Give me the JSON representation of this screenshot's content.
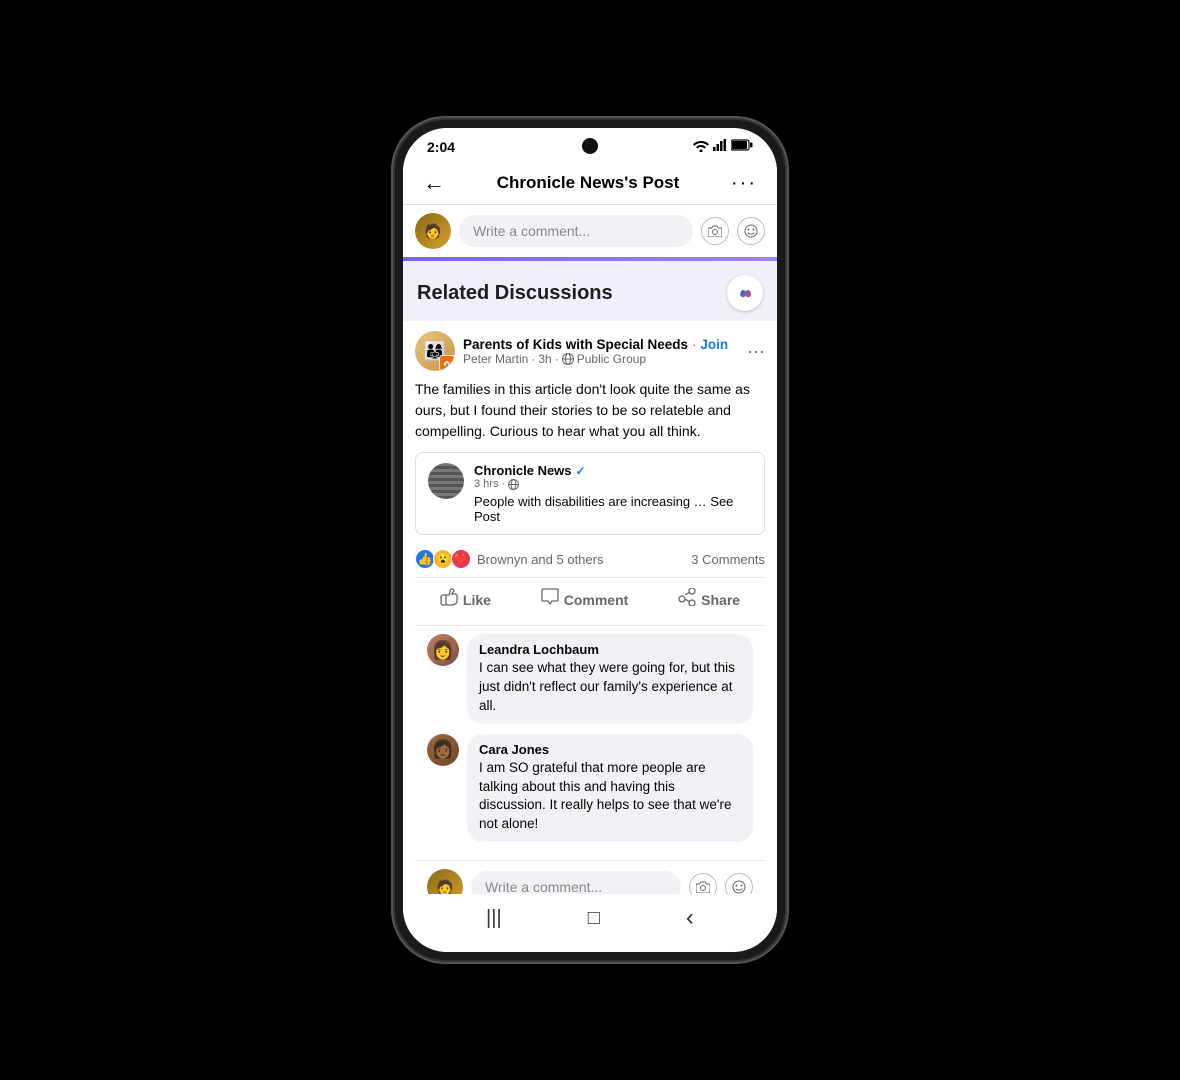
{
  "status_bar": {
    "time": "2:04",
    "wifi": "▼",
    "signal": "▲",
    "battery": "🔋"
  },
  "nav": {
    "title": "Chronicle News's Post",
    "back": "←",
    "more": "···"
  },
  "comment_input_top": {
    "placeholder": "Write a comment..."
  },
  "related_discussions": {
    "title": "Related Discussions"
  },
  "post": {
    "group_name": "Parents of Kids with Special Needs",
    "join_label": "Join",
    "author": "Peter Martin",
    "time": "3h",
    "group_type": "Public Group",
    "body": "The families in this article don't look quite the same as ours, but I found their stories to be so relateble and compelling. Curious to hear what you all think.",
    "embedded": {
      "source_name": "Chronicle News",
      "time": "3 hrs",
      "text": "People with disabilities are increasing … See Post"
    },
    "reactions": {
      "names": "Brownyn and 5 others",
      "comments_count": "3 Comments"
    },
    "actions": {
      "like": "Like",
      "comment": "Comment",
      "share": "Share"
    }
  },
  "comments": [
    {
      "author": "Leandra Lochbaum",
      "text": "I can see what they were going for, but this just didn't reflect our family's experience at all."
    },
    {
      "author": "Cara Jones",
      "text": "I am SO grateful that more people are talking about this and having this discussion. It really helps to see that we're not alone!"
    }
  ],
  "comment_input_bottom": {
    "placeholder": "Write a comment..."
  },
  "bottom_nav": {
    "menu": "|||",
    "home": "□",
    "back": "‹"
  }
}
